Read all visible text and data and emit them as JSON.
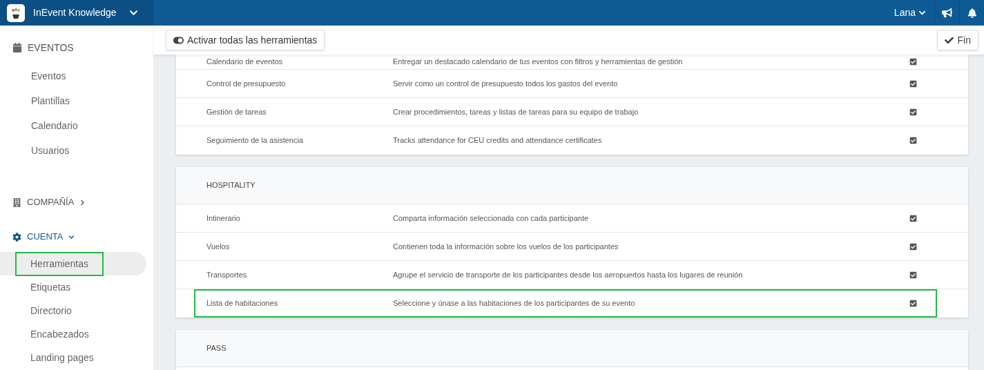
{
  "topbar": {
    "title": "InEvent Knowledge",
    "user": "Lana"
  },
  "sidebar": {
    "sections": [
      {
        "label": "EVENTOS",
        "kind": "events",
        "expanded": true,
        "items": [
          {
            "label": "Eventos",
            "selected": false,
            "highlighted": false
          },
          {
            "label": "Plantillas",
            "selected": false,
            "highlighted": false
          },
          {
            "label": "Calendario",
            "selected": false,
            "highlighted": false
          },
          {
            "label": "Usuarios",
            "selected": false,
            "highlighted": false
          }
        ]
      },
      {
        "label": "COMPAÑÍA",
        "kind": "company",
        "expanded": false
      },
      {
        "label": "CUENTA",
        "kind": "account",
        "expanded": true,
        "items": [
          {
            "label": "Herramientas",
            "selected": true,
            "highlighted": true
          },
          {
            "label": "Etiquetas",
            "selected": false,
            "highlighted": false
          },
          {
            "label": "Directorio",
            "selected": false,
            "highlighted": false
          },
          {
            "label": "Encabezados",
            "selected": false,
            "highlighted": false
          },
          {
            "label": "Landing pages",
            "selected": false,
            "highlighted": false
          }
        ]
      }
    ]
  },
  "toolbar": {
    "activate_all": "Activar todas las herramientas",
    "done": "Fin"
  },
  "cards": [
    {
      "rows": [
        {
          "name": "Calendario de eventos",
          "description": "Entregar un destacado calendario de tus eventos con filtros y herramientas de gestión",
          "checked": true,
          "highlighted": false
        },
        {
          "name": "Control de presupuesto",
          "description": "Servir como un control de presupuesto todos los gastos del evento",
          "checked": true,
          "highlighted": false
        },
        {
          "name": "Gestión de tareas",
          "description": "Crear procedimientos, tareas y listas de tareas para su equipo de trabajo",
          "checked": true,
          "highlighted": false
        },
        {
          "name": "Seguimiento de la asistencia",
          "description": "Tracks attendance for CEU credits and attendance certificates",
          "checked": true,
          "highlighted": false
        }
      ]
    },
    {
      "heading": "HOSPITALITY",
      "rows": [
        {
          "name": "Intinerario",
          "description": "Comparta información seleccionada con cada participante",
          "checked": true,
          "highlighted": false
        },
        {
          "name": "Vuelos",
          "description": "Contienen toda la información sobre los vuelos de los participantes",
          "checked": true,
          "highlighted": false
        },
        {
          "name": "Transportes",
          "description": "Agrupe el servicio de transporte de los participantes desde los aeropuertos hasta los lugares de reunión",
          "checked": true,
          "highlighted": false
        },
        {
          "name": "Lista de habitaciones",
          "description": "Seleccione y únase a las habitaciones de los participantes de su evento",
          "checked": true,
          "highlighted": true
        }
      ]
    },
    {
      "heading": "PASS"
    }
  ]
}
